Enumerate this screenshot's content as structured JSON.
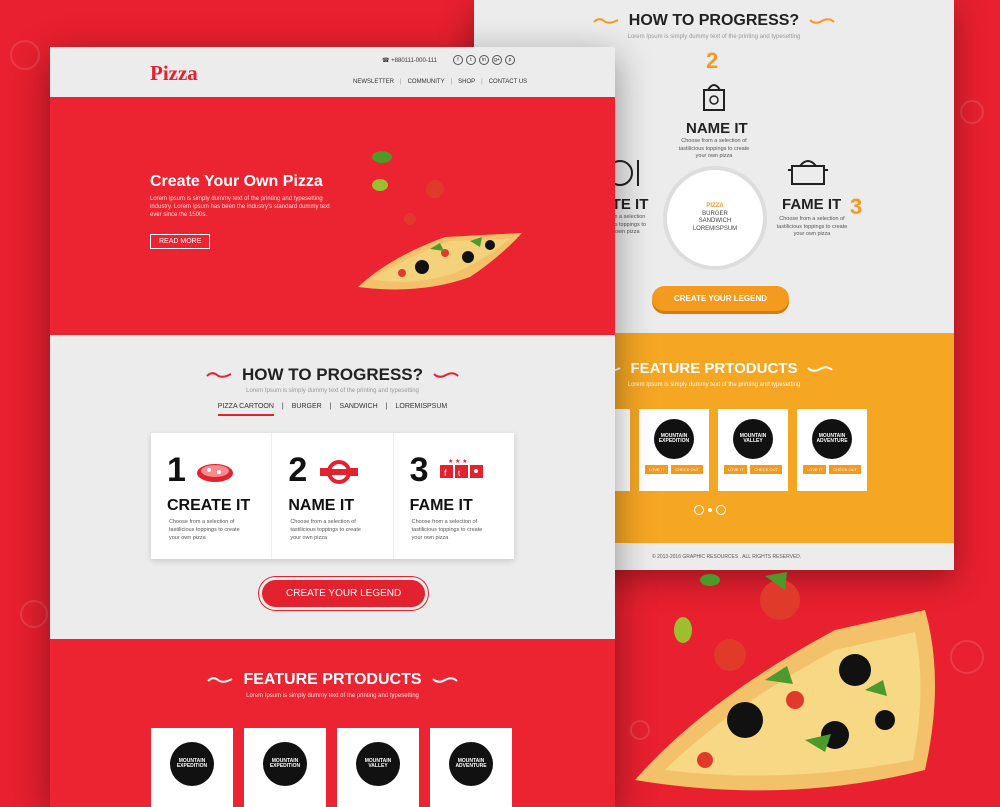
{
  "back": {
    "how_title": "HOW TO PROGRESS?",
    "how_sub": "Lorem Ipsum is simply dummy text of the printing and typesetting",
    "num2": "2",
    "num3": "3",
    "name_it": "NAME IT",
    "name_it_text": "Choose from a selection of tastilicious toppings to create your own pizza",
    "create_it_partial": "ATE IT",
    "create_it_text": "Choose from a selection of tastilicious toppings to create your own pizza",
    "fame_it": "FAME IT",
    "fame_it_text": "Choose from a selection of tastilicious toppings to create your own pizza",
    "wheel": [
      "PIZZA",
      "BURGER",
      "SANDWICH",
      "LOREMISPSUM"
    ],
    "create_btn": "CREATE YOUR LEGEND",
    "feature_title": "FEATURE PRTODUCTS",
    "feature_sub": "Lorem Ipsum is simply dummy text of the printing and typesetting",
    "products": [
      {
        "logo": "MOUNTAIN EXPEDITION",
        "love": "LOVE IT",
        "check": "CHECK OUT"
      },
      {
        "logo": "MOUNTAIN VALLEY",
        "love": "LOVE IT",
        "check": "CHECK OUT"
      },
      {
        "logo": "MOUNTAIN ADVENTURE",
        "love": "LOVE IT",
        "check": "CHECK OUT"
      }
    ],
    "footer": "© 2013-2016 GRAPHIC RESOURCES . ALL RIGHTS RESERVED."
  },
  "front": {
    "logo": "Pizza",
    "phone": "+880111-000-111",
    "socials": [
      "f",
      "t",
      "in",
      "g+",
      "p"
    ],
    "nav": [
      "NEWSLETTER",
      "COMMUNITY",
      "SHOP",
      "CONTACT US"
    ],
    "hero_title": "Create Your Own Pizza",
    "hero_text": "Lorem Ipsum is simply dummy text of the printing and typesetting industry. Lorem Ipsum has been the industry's standard dummy text ever since the 1500s.",
    "read_more": "READ MORE",
    "how_title": "HOW TO PROGRESS?",
    "how_sub": "Lorem Ipsum is simply dummy text of the printing and typesetting",
    "tabs": [
      "PIZZA CARTOON",
      "BURGER",
      "SANDWICH",
      "LOREMISPSUM"
    ],
    "steps": [
      {
        "num": "1",
        "name": "CREATE IT",
        "desc": "Choose from a selection of tastilicious toppings to create your own pizza"
      },
      {
        "num": "2",
        "name": "NAME IT",
        "desc": "Choose from a selection of tastilicious toppings to create your own pizza"
      },
      {
        "num": "3",
        "name": "FAME IT",
        "desc": "Choose from a selection of tastilicious toppings to create your own pizza"
      }
    ],
    "create_btn": "CREATE YOUR LEGEND",
    "feature_title": "FEATURE PRTODUCTS",
    "feature_sub": "Lorem Ipsum is simply dummy text of the printing and typesetting",
    "products": [
      "MOUNTAIN EXPEDITION",
      "MOUNTAIN EXPEDITION",
      "MOUNTAIN VALLEY",
      "MOUNTAIN ADVENTURE"
    ]
  },
  "colors": {
    "red": "#e3222f",
    "orange": "#f39a1f",
    "light": "#ececec"
  }
}
